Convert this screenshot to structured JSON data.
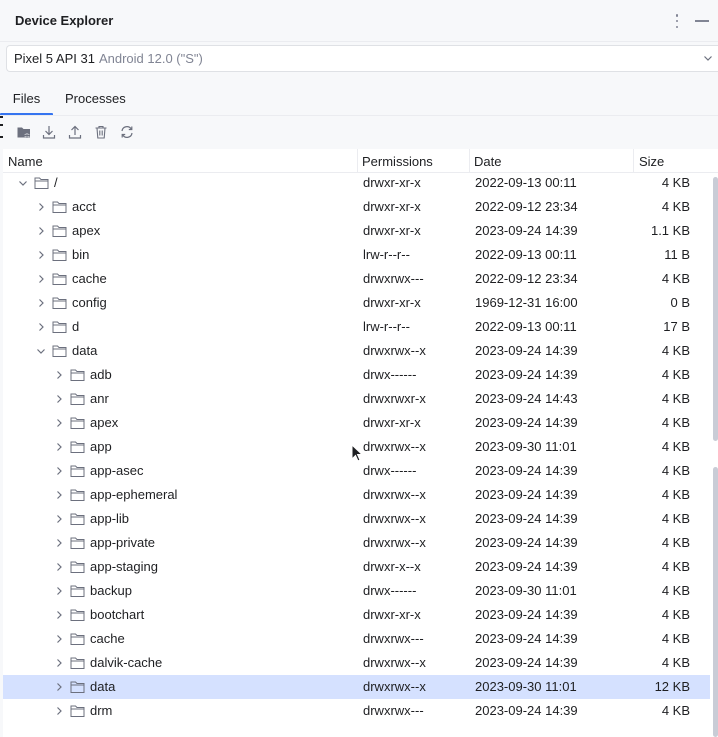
{
  "window": {
    "title": "Device Explorer"
  },
  "device": {
    "name": "Pixel 5 API 31",
    "os": "Android 12.0 (\"S\")"
  },
  "tabs": [
    {
      "label": "Files",
      "active": true
    },
    {
      "label": "Processes",
      "active": false
    }
  ],
  "toolbar": {
    "buttons": [
      {
        "icon": "new-folder-icon"
      },
      {
        "icon": "download-icon"
      },
      {
        "icon": "upload-icon"
      },
      {
        "icon": "delete-icon"
      },
      {
        "icon": "refresh-icon"
      }
    ]
  },
  "table": {
    "columns": {
      "name": "Name",
      "permissions": "Permissions",
      "date": "Date",
      "size": "Size"
    },
    "rows": [
      {
        "name": "/",
        "perm": "drwxr-xr-x",
        "date": "2022-09-13 00:11",
        "size": "4 KB",
        "depth": 0,
        "expanded": true
      },
      {
        "name": "acct",
        "perm": "drwxr-xr-x",
        "date": "2022-09-12 23:34",
        "size": "4 KB",
        "depth": 1,
        "expanded": false
      },
      {
        "name": "apex",
        "perm": "drwxr-xr-x",
        "date": "2023-09-24 14:39",
        "size": "1.1 KB",
        "depth": 1,
        "expanded": false
      },
      {
        "name": "bin",
        "perm": "lrw-r--r--",
        "date": "2022-09-13 00:11",
        "size": "11 B",
        "depth": 1,
        "expanded": false
      },
      {
        "name": "cache",
        "perm": "drwxrwx---",
        "date": "2022-09-12 23:34",
        "size": "4 KB",
        "depth": 1,
        "expanded": false
      },
      {
        "name": "config",
        "perm": "drwxr-xr-x",
        "date": "1969-12-31 16:00",
        "size": "0 B",
        "depth": 1,
        "expanded": false
      },
      {
        "name": "d",
        "perm": "lrw-r--r--",
        "date": "2022-09-13 00:11",
        "size": "17 B",
        "depth": 1,
        "expanded": false
      },
      {
        "name": "data",
        "perm": "drwxrwx--x",
        "date": "2023-09-24 14:39",
        "size": "4 KB",
        "depth": 1,
        "expanded": true
      },
      {
        "name": "adb",
        "perm": "drwx------",
        "date": "2023-09-24 14:39",
        "size": "4 KB",
        "depth": 2,
        "expanded": false
      },
      {
        "name": "anr",
        "perm": "drwxrwxr-x",
        "date": "2023-09-24 14:43",
        "size": "4 KB",
        "depth": 2,
        "expanded": false
      },
      {
        "name": "apex",
        "perm": "drwxr-xr-x",
        "date": "2023-09-24 14:39",
        "size": "4 KB",
        "depth": 2,
        "expanded": false
      },
      {
        "name": "app",
        "perm": "drwxrwx--x",
        "date": "2023-09-30 11:01",
        "size": "4 KB",
        "depth": 2,
        "expanded": false
      },
      {
        "name": "app-asec",
        "perm": "drwx------",
        "date": "2023-09-24 14:39",
        "size": "4 KB",
        "depth": 2,
        "expanded": false
      },
      {
        "name": "app-ephemeral",
        "perm": "drwxrwx--x",
        "date": "2023-09-24 14:39",
        "size": "4 KB",
        "depth": 2,
        "expanded": false
      },
      {
        "name": "app-lib",
        "perm": "drwxrwx--x",
        "date": "2023-09-24 14:39",
        "size": "4 KB",
        "depth": 2,
        "expanded": false
      },
      {
        "name": "app-private",
        "perm": "drwxrwx--x",
        "date": "2023-09-24 14:39",
        "size": "4 KB",
        "depth": 2,
        "expanded": false
      },
      {
        "name": "app-staging",
        "perm": "drwxr-x--x",
        "date": "2023-09-24 14:39",
        "size": "4 KB",
        "depth": 2,
        "expanded": false
      },
      {
        "name": "backup",
        "perm": "drwx------",
        "date": "2023-09-30 11:01",
        "size": "4 KB",
        "depth": 2,
        "expanded": false
      },
      {
        "name": "bootchart",
        "perm": "drwxr-xr-x",
        "date": "2023-09-24 14:39",
        "size": "4 KB",
        "depth": 2,
        "expanded": false
      },
      {
        "name": "cache",
        "perm": "drwxrwx---",
        "date": "2023-09-24 14:39",
        "size": "4 KB",
        "depth": 2,
        "expanded": false
      },
      {
        "name": "dalvik-cache",
        "perm": "drwxrwx--x",
        "date": "2023-09-24 14:39",
        "size": "4 KB",
        "depth": 2,
        "expanded": false
      },
      {
        "name": "data",
        "perm": "drwxrwx--x",
        "date": "2023-09-30 11:01",
        "size": "12 KB",
        "depth": 2,
        "expanded": false,
        "selected": true
      },
      {
        "name": "drm",
        "perm": "drwxrwx---",
        "date": "2023-09-24 14:39",
        "size": "4 KB",
        "depth": 2,
        "expanded": false
      }
    ]
  },
  "colors": {
    "accent": "#3574f0",
    "selection": "#d5e1ff",
    "icon": "#6c707e"
  }
}
